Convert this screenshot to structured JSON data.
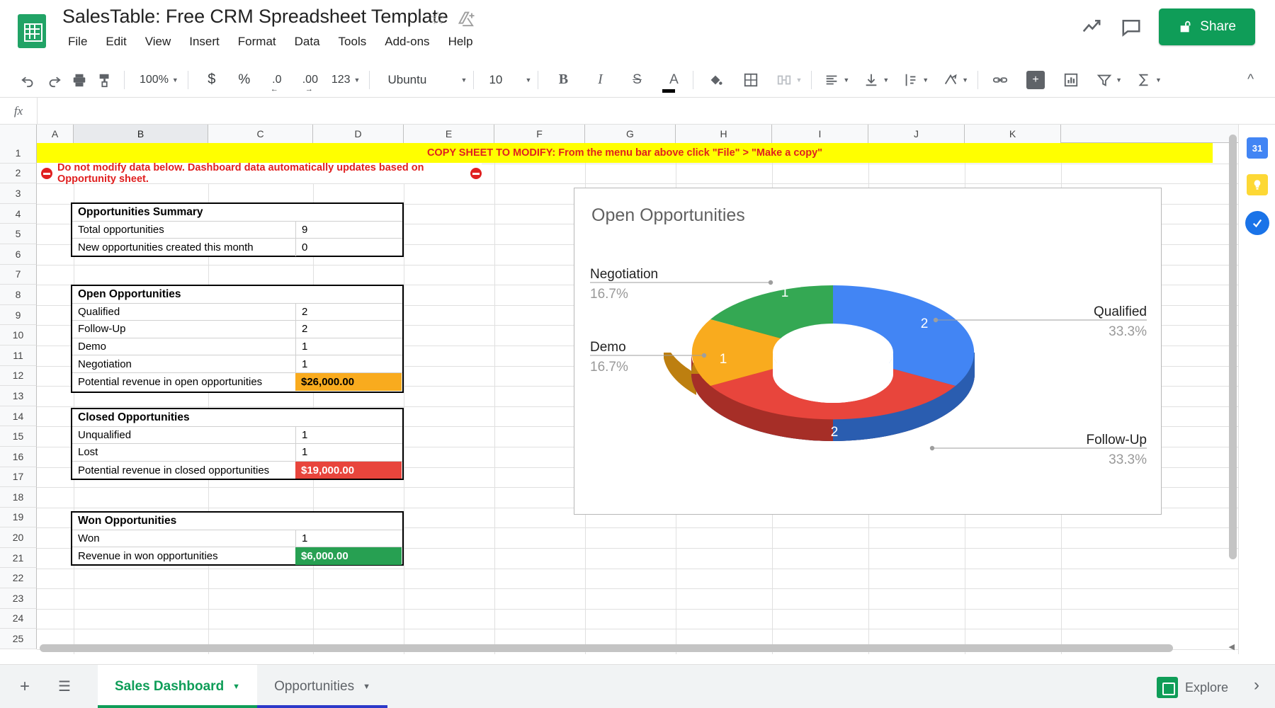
{
  "header": {
    "doc_title": "SalesTable: Free CRM Spreadsheet Template",
    "star_icon": "star-icon",
    "drive_icon": "move-to-drive-icon",
    "menus": [
      "File",
      "Edit",
      "View",
      "Insert",
      "Format",
      "Data",
      "Tools",
      "Add-ons",
      "Help"
    ],
    "activity_icon": "activity-trend-icon",
    "comment_icon": "comment-icon",
    "share_label": "Share",
    "share_icon": "lock-share-icon",
    "share_color": "#0f9d58"
  },
  "toolbar": {
    "undo": "undo-icon",
    "redo": "redo-icon",
    "print": "print-icon",
    "paint": "paint-format-icon",
    "zoom_value": "100%",
    "currency": "$",
    "percent": "%",
    "decrease_decimal": ".0",
    "increase_decimal": ".00",
    "more_formats": "123",
    "font_name": "Ubuntu",
    "font_size": "10",
    "bold": "B",
    "italic": "I",
    "strikethrough": "S",
    "text_color": "A",
    "fill_color": "fill-color-icon",
    "borders": "borders-icon",
    "merge_cells": "merge-cells-icon",
    "horiz_align": "horizontal-align-icon",
    "vert_align": "vertical-align-icon",
    "text_wrap": "text-wrapping-icon",
    "text_rotation": "text-rotation-icon",
    "insert_link": "insert-link-icon",
    "insert_comment": "insert-comment-icon",
    "insert_chart": "insert-chart-icon",
    "filter": "filter-icon",
    "functions": "functions-sigma-icon",
    "collapse": "collapse-toolbar-icon"
  },
  "formula_bar": {
    "fx_label": "fx",
    "value": ""
  },
  "grid": {
    "columns": [
      "A",
      "B",
      "C",
      "D",
      "E",
      "F",
      "G",
      "H",
      "I",
      "J",
      "K"
    ],
    "selected_column": "B",
    "rows": [
      "1",
      "2",
      "3",
      "4",
      "5",
      "6",
      "7",
      "8",
      "9",
      "10",
      "11",
      "12",
      "13",
      "14",
      "15",
      "16",
      "17",
      "18",
      "19",
      "20",
      "21",
      "22",
      "23",
      "24",
      "25"
    ],
    "banner": "COPY SHEET TO MODIFY: From the menu bar above click \"File\" > \"Make a copy\"",
    "warning": "Do not modify data below. Dashboard data automatically updates based on Opportunity sheet.",
    "warning_icon": "stop-sign-icon"
  },
  "tables": [
    {
      "title": "Opportunities Summary",
      "rows": [
        {
          "label": "Total opportunities",
          "value": "9",
          "style": "plain"
        },
        {
          "label": "New opportunities created this month",
          "value": "0",
          "style": "plain"
        }
      ]
    },
    {
      "title": "Open Opportunities",
      "rows": [
        {
          "label": "Qualified",
          "value": "2",
          "style": "plain"
        },
        {
          "label": "Follow-Up",
          "value": "2",
          "style": "plain"
        },
        {
          "label": "Demo",
          "value": "1",
          "style": "plain"
        },
        {
          "label": "Negotiation",
          "value": "1",
          "style": "plain"
        },
        {
          "label": "Potential revenue in open opportunities",
          "value": "$26,000.00",
          "style": "amber"
        }
      ]
    },
    {
      "title": "Closed Opportunities",
      "rows": [
        {
          "label": "Unqualified",
          "value": "1",
          "style": "plain"
        },
        {
          "label": "Lost",
          "value": "1",
          "style": "plain"
        },
        {
          "label": "Potential revenue in closed opportunities",
          "value": "$19,000.00",
          "style": "red"
        }
      ]
    },
    {
      "title": "Won Opportunities",
      "rows": [
        {
          "label": "Won",
          "value": "1",
          "style": "plain"
        },
        {
          "label": "Revenue in won opportunities",
          "value": "$6,000.00",
          "style": "green"
        }
      ]
    }
  ],
  "chart_data": {
    "type": "pie",
    "variant": "3d-donut",
    "title": "Open Opportunities",
    "categories": [
      "Qualified",
      "Follow-Up",
      "Demo",
      "Negotiation"
    ],
    "values": [
      2,
      2,
      1,
      1
    ],
    "percents": [
      "33.3%",
      "33.3%",
      "16.7%",
      "16.7%"
    ],
    "colors": [
      "#4285f4",
      "#e8453c",
      "#f9ab1e",
      "#34a853"
    ],
    "side_colors": [
      "#2a5db0",
      "#a62e27",
      "#bd7f10",
      "#23753a"
    ],
    "labels": [
      {
        "name": "Qualified",
        "percent": "33.3%",
        "value": "2"
      },
      {
        "name": "Follow-Up",
        "percent": "33.3%",
        "value": "2"
      },
      {
        "name": "Demo",
        "percent": "16.7%",
        "value": "1"
      },
      {
        "name": "Negotiation",
        "percent": "16.7%",
        "value": "1"
      }
    ],
    "legend": "labeled-callouts",
    "grid": false
  },
  "side_panel": {
    "calendar_icon": "calendar-icon",
    "calendar_day": "31",
    "keep_icon": "keep-icon",
    "tasks_icon": "tasks-icon"
  },
  "sheet_tabs": {
    "add_icon": "add-sheet-icon",
    "all_sheets_icon": "all-sheets-icon",
    "tabs": [
      {
        "label": "Sales Dashboard",
        "active": true,
        "color": "#0f9d58"
      },
      {
        "label": "Opportunities",
        "active": false,
        "color": "#2c39c9"
      }
    ],
    "dropdown_icon": "chevron-down-icon",
    "explore_label": "Explore",
    "explore_icon": "explore-icon",
    "expand_icon": "chevron-right-icon"
  }
}
